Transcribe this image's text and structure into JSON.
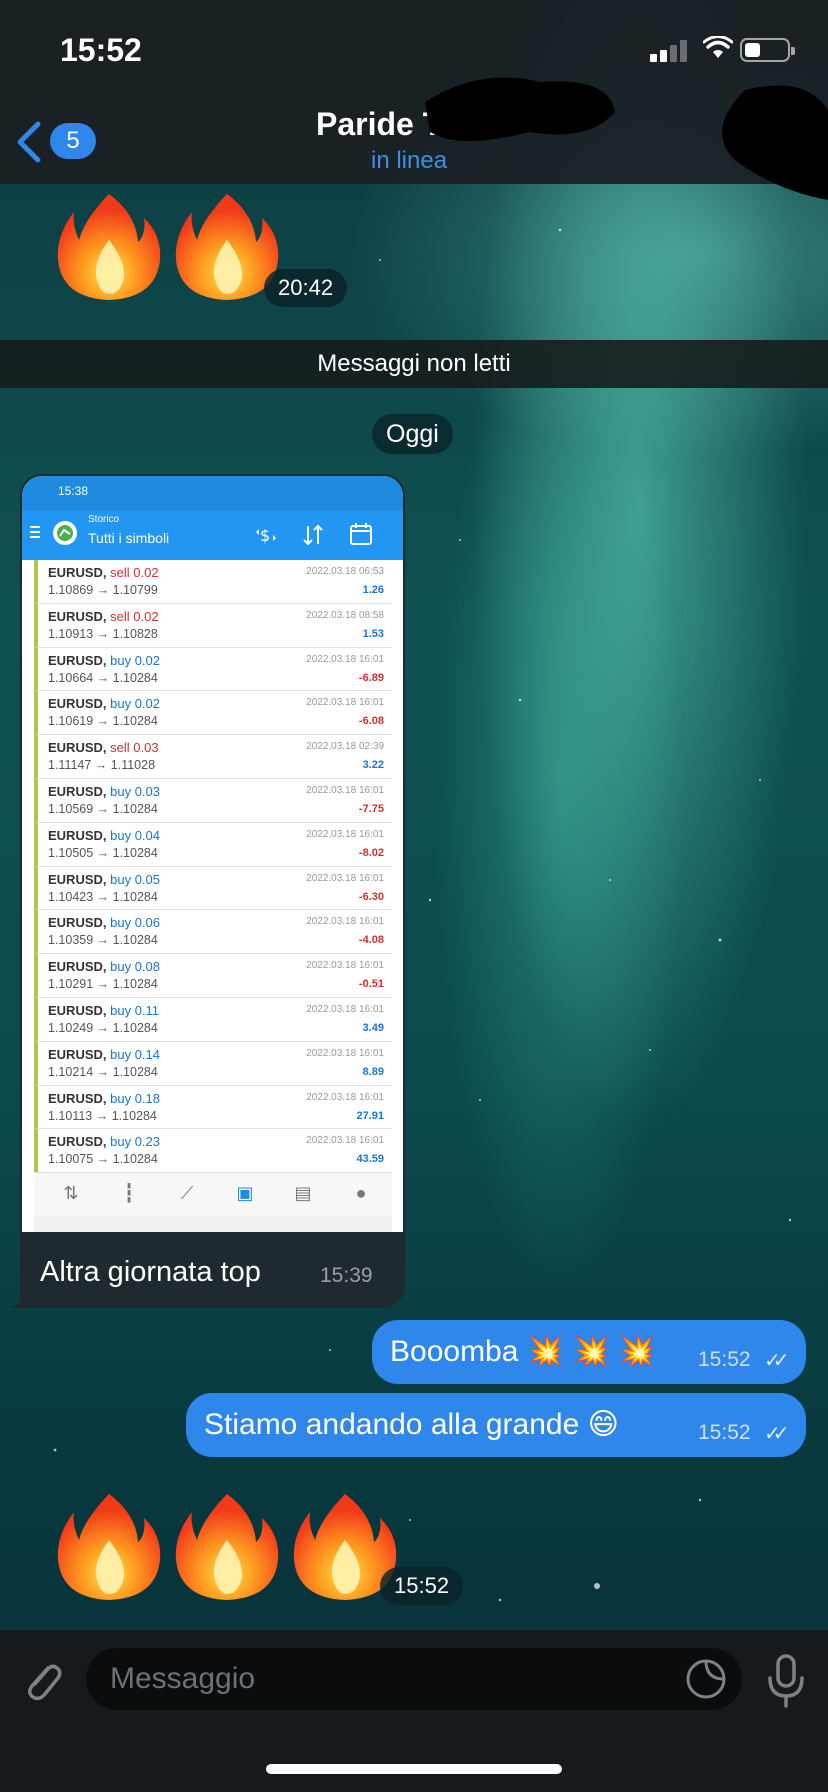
{
  "status_bar": {
    "time": "15:52"
  },
  "header": {
    "back_count": "5",
    "contact_name": "Paride T",
    "contact_status": "in linea"
  },
  "messages": {
    "first_emoji_time": "20:42",
    "unread_banner": "Messaggi non letti",
    "date_separator": "Oggi",
    "photo_caption": "Altra giornata top",
    "photo_time": "15:39",
    "out1_text": "Booomba 💥 💥 💥",
    "out1_time": "15:52",
    "out2_text": "Stiamo andando alla grande 😄",
    "out2_time": "15:52",
    "last_emoji_time": "15:52"
  },
  "screenshot": {
    "status_time": "15:38",
    "title_small": "Storico",
    "title_main": "Tutti i simboli",
    "trades": [
      {
        "symbol": "EURUSD,",
        "side": "sell 0.02",
        "type": "sell",
        "prices": "1.10869 → 1.10799",
        "date": "2022.03.18 06:53",
        "pnl": "1.26",
        "pnl_type": "pos"
      },
      {
        "symbol": "EURUSD,",
        "side": "sell 0.02",
        "type": "sell",
        "prices": "1.10913 → 1.10828",
        "date": "2022.03.18 08:58",
        "pnl": "1.53",
        "pnl_type": "pos"
      },
      {
        "symbol": "EURUSD,",
        "side": "buy 0.02",
        "type": "buy",
        "prices": "1.10664 → 1.10284",
        "date": "2022.03.18 16:01",
        "pnl": "-6.89",
        "pnl_type": "neg"
      },
      {
        "symbol": "EURUSD,",
        "side": "buy 0.02",
        "type": "buy",
        "prices": "1.10619 → 1.10284",
        "date": "2022.03.18 16:01",
        "pnl": "-6.08",
        "pnl_type": "neg"
      },
      {
        "symbol": "EURUSD,",
        "side": "sell 0.03",
        "type": "sell",
        "prices": "1.11147 → 1.11028",
        "date": "2022.03.18 02:39",
        "pnl": "3.22",
        "pnl_type": "pos"
      },
      {
        "symbol": "EURUSD,",
        "side": "buy 0.03",
        "type": "buy",
        "prices": "1.10569 → 1.10284",
        "date": "2022.03.18 16:01",
        "pnl": "-7.75",
        "pnl_type": "neg"
      },
      {
        "symbol": "EURUSD,",
        "side": "buy 0.04",
        "type": "buy",
        "prices": "1.10505 → 1.10284",
        "date": "2022.03.18 16:01",
        "pnl": "-8.02",
        "pnl_type": "neg"
      },
      {
        "symbol": "EURUSD,",
        "side": "buy 0.05",
        "type": "buy",
        "prices": "1.10423 → 1.10284",
        "date": "2022.03.18 16:01",
        "pnl": "-6.30",
        "pnl_type": "neg"
      },
      {
        "symbol": "EURUSD,",
        "side": "buy 0.06",
        "type": "buy",
        "prices": "1.10359 → 1.10284",
        "date": "2022.03.18 16:01",
        "pnl": "-4.08",
        "pnl_type": "neg"
      },
      {
        "symbol": "EURUSD,",
        "side": "buy 0.08",
        "type": "buy",
        "prices": "1.10291 → 1.10284",
        "date": "2022.03.18 16:01",
        "pnl": "-0.51",
        "pnl_type": "neg"
      },
      {
        "symbol": "EURUSD,",
        "side": "buy 0.11",
        "type": "buy",
        "prices": "1.10249 → 1.10284",
        "date": "2022.03.18 16:01",
        "pnl": "3.49",
        "pnl_type": "pos"
      },
      {
        "symbol": "EURUSD,",
        "side": "buy 0.14",
        "type": "buy",
        "prices": "1.10214 → 1.10284",
        "date": "2022.03.18 16:01",
        "pnl": "8.89",
        "pnl_type": "pos"
      },
      {
        "symbol": "EURUSD,",
        "side": "buy 0.18",
        "type": "buy",
        "prices": "1.10113 → 1.10284",
        "date": "2022.03.18 16:01",
        "pnl": "27.91",
        "pnl_type": "pos"
      },
      {
        "symbol": "EURUSD,",
        "side": "buy 0.23",
        "type": "buy",
        "prices": "1.10075 → 1.10284",
        "date": "2022.03.18 16:01",
        "pnl": "43.59",
        "pnl_type": "pos"
      }
    ]
  },
  "input": {
    "placeholder": "Messaggio"
  },
  "colors": {
    "accent": "#2f86eb",
    "header_bg": "#1a2024",
    "unread_banner_bg": "#161c1e"
  },
  "icons": [
    "back-chevron-icon",
    "fire-emoji",
    "attach-icon",
    "sticker-icon",
    "mic-icon"
  ]
}
